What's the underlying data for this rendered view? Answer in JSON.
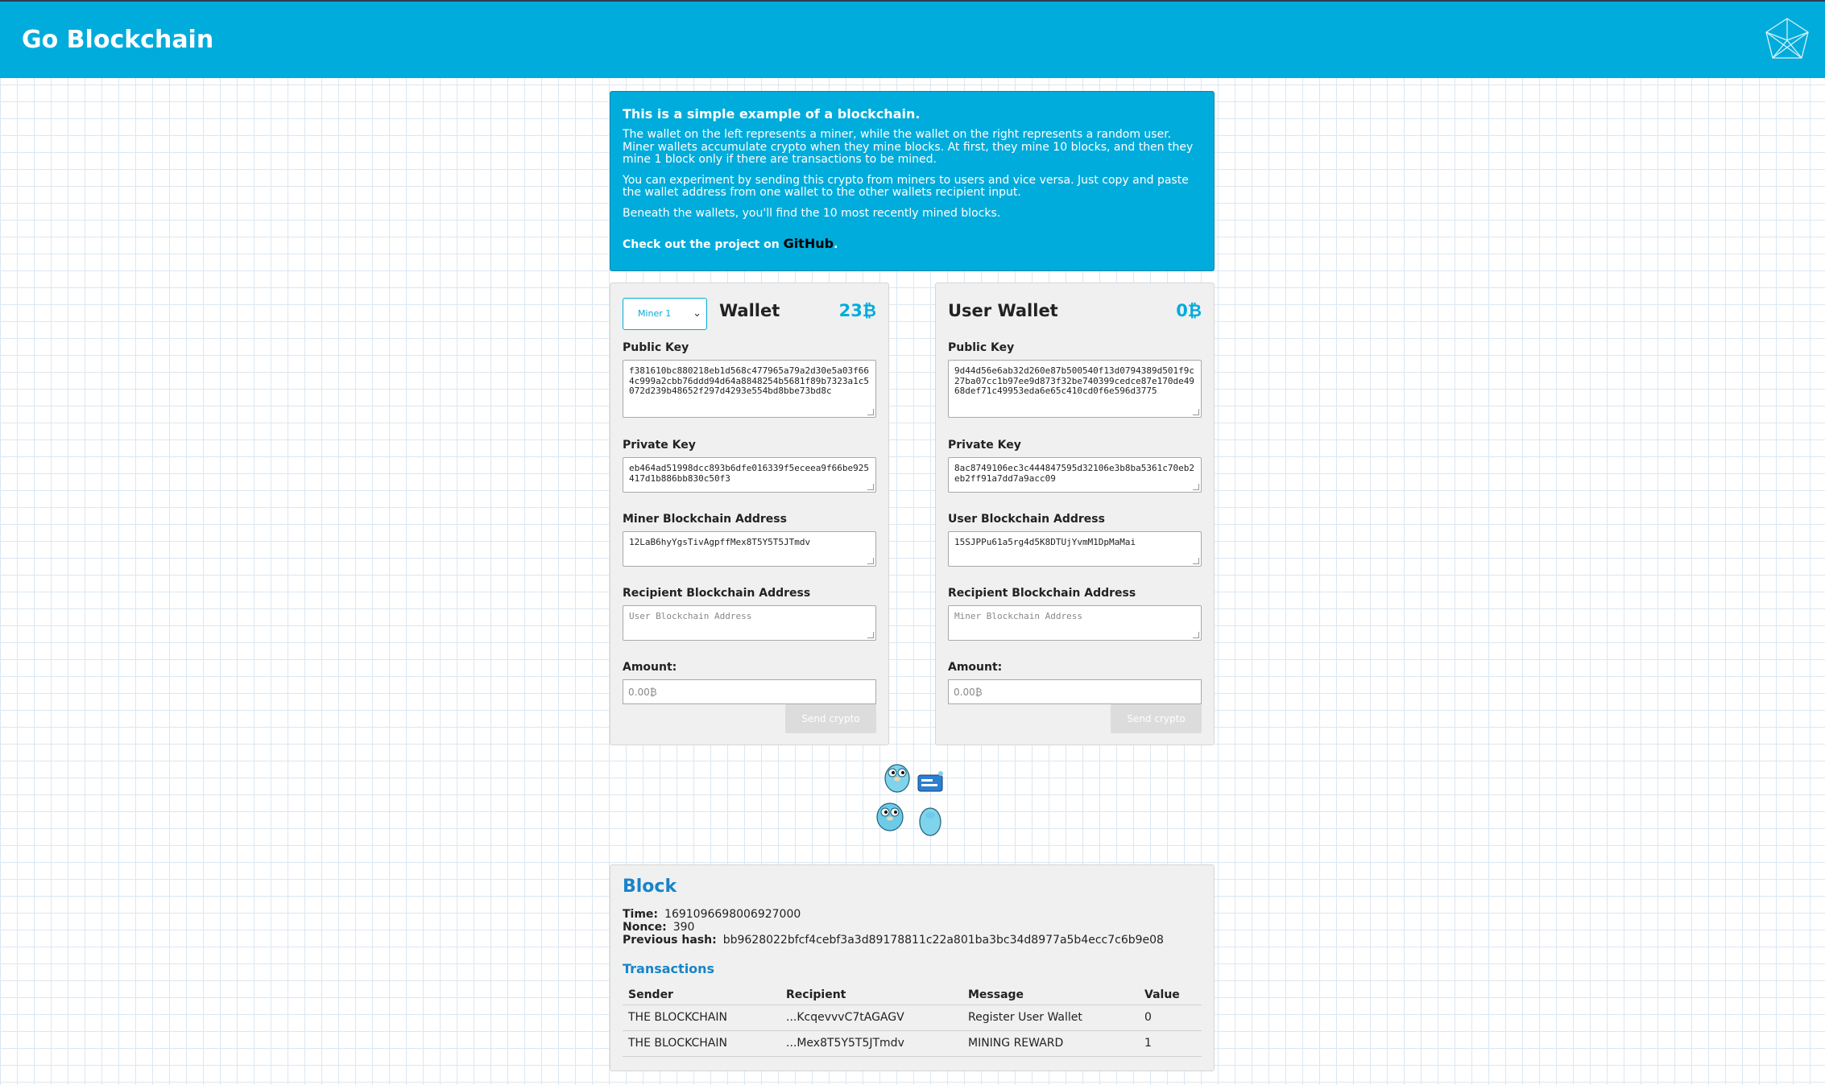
{
  "header": {
    "brand": "Go Blockchain",
    "logo_icon": "cube-outline-icon"
  },
  "info": {
    "heading": "This is a simple example of a blockchain.",
    "p1": "The wallet on the left represents a miner, while the wallet on the right represents a random user. Miner wallets accumulate crypto when they mine blocks. At first, they mine 10 blocks, and then they mine 1 block only if there are transactions to be mined.",
    "p2": "You can experiment by sending this crypto from miners to users and vice versa. Just copy and paste the wallet address from one wallet to the other wallets recipient input.",
    "p3": "Beneath the wallets, you'll find the 10 most recently mined blocks.",
    "github_prefix": "Check out the project on ",
    "github_link": "GitHub",
    "github_suffix": "."
  },
  "miner_wallet": {
    "selector_value": "Miner 1",
    "title": "Wallet",
    "balance": "23₿",
    "public_key_label": "Public Key",
    "public_key": "f381610bc880218eb1d568c477965a79a2d30e5a03f664c999a2cbb76ddd94d64a8848254b5681f89b7323a1c5072d239b48652f297d4293e554bd8bbe73bd8c",
    "private_key_label": "Private Key",
    "private_key": "eb464ad51998dcc893b6dfe016339f5eceea9f66be925417d1b886bb830c50f3",
    "address_label": "Miner Blockchain Address",
    "address": "12LaB6hyYgsTivAgpffMex8T5Y5T5JTmdv",
    "recipient_label": "Recipient Blockchain Address",
    "recipient_placeholder": "User Blockchain Address",
    "amount_label": "Amount:",
    "amount_placeholder": "0.00₿",
    "send_label": "Send crypto"
  },
  "user_wallet": {
    "title": "User Wallet",
    "balance": "0₿",
    "public_key_label": "Public Key",
    "public_key": "9d44d56e6ab32d260e87b500540f13d0794389d501f9c27ba07cc1b97ee9d873f32be740399cedce87e170de4968def71c49953eda6e65c410cd0f6e596d3775",
    "private_key_label": "Private Key",
    "private_key": "8ac8749106ec3c444847595d32106e3b8ba5361c70eb2eb2ff91a7dd7a9acc09",
    "address_label": "User Blockchain Address",
    "address": "15SJPPu61a5rg4d5K8DTUjYvmM1DpMaMai",
    "recipient_label": "Recipient Blockchain Address",
    "recipient_placeholder": "Miner Blockchain Address",
    "amount_label": "Amount:",
    "amount_placeholder": "0.00₿",
    "send_label": "Send crypto"
  },
  "block": {
    "title": "Block",
    "time_label": "Time:",
    "time": "1691096698006927000",
    "nonce_label": "Nonce:",
    "nonce": "390",
    "prev_hash_label": "Previous hash:",
    "prev_hash": "bb9628022bfcf4cebf3a3d89178811c22a801ba3bc34d8977a5b4ecc7c6b9e08",
    "transactions_title": "Transactions",
    "columns": [
      "Sender",
      "Recipient",
      "Message",
      "Value"
    ],
    "rows": [
      {
        "sender": "THE BLOCKCHAIN",
        "recipient": "...KcqevvvC7tAGAGV",
        "message": "Register User Wallet",
        "value": "0"
      },
      {
        "sender": "THE BLOCKCHAIN",
        "recipient": "...Mex8T5Y5T5JTmdv",
        "message": "MINING REWARD",
        "value": "1"
      }
    ]
  },
  "colors": {
    "accent": "#00acdc",
    "block_title": "#1784c9"
  }
}
